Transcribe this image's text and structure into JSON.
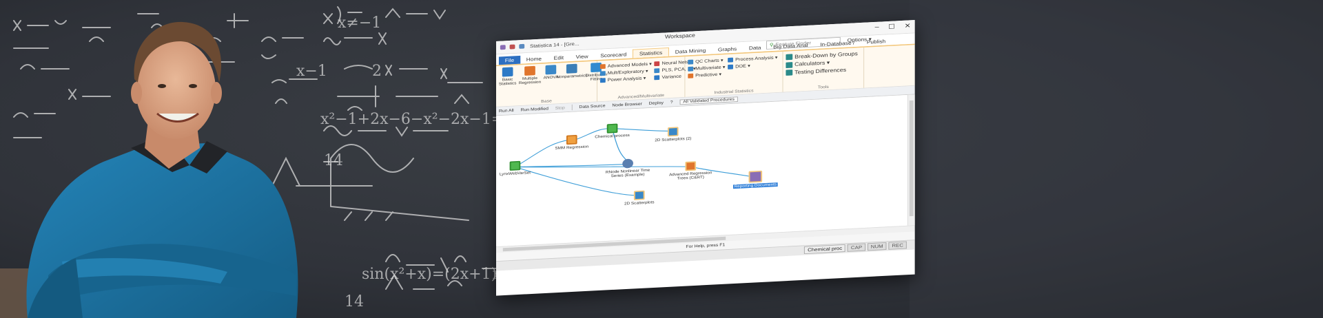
{
  "window": {
    "doc_title": "Statistica 14 - [Gre...",
    "title": "Workspace",
    "controls": [
      "–",
      "☐",
      "✕"
    ]
  },
  "menu": {
    "items": [
      "File",
      "Home",
      "Edit",
      "View",
      "Scorecard",
      "Statistics",
      "Data Mining",
      "Graphs",
      "Data",
      "Big Data Anal",
      "In-Database /",
      "Publish"
    ],
    "active": "Statistics",
    "search_placeholder": "Feature Finder",
    "options_label": "Options ▾"
  },
  "ribbon": {
    "base": {
      "label": "Base",
      "buttons": [
        "Basic Statistics",
        "Multiple Regression",
        "ANOVA",
        "Nonparametrics",
        "Distribution Fitting"
      ]
    },
    "advanced": {
      "label": "Advanced/Multivariate",
      "items": [
        "Advanced Models ▾",
        "Neural Nets ▾",
        "Mult/Exploratory ▾",
        "PLS, PCA, ... ▾",
        "Power Analysis ▾",
        "Variance"
      ]
    },
    "industrial": {
      "label": "Industrial Statistics",
      "items": [
        "QC Charts ▾",
        "Process Analysis ▾",
        "Multivariate ▾",
        "DOE ▾",
        "Predictive ▾"
      ]
    },
    "tools": {
      "label": "Tools",
      "items": [
        "Break-Down by Groups",
        "Calculators ▾",
        "Testing Differences"
      ]
    }
  },
  "toolbar": {
    "run_all": "Run All",
    "run_modified": "Run Modified",
    "stop": "Stop",
    "data_source": "Data Source",
    "node_browser": "Node Browser",
    "deploy": "Deploy",
    "help": "?",
    "procedures": "All Validated Procedures"
  },
  "workflow": {
    "nodes": [
      {
        "id": "lynx",
        "label": "LynxWebVarSet",
        "kind": "data"
      },
      {
        "id": "smm",
        "label": "SMM Regression",
        "kind": "analysis"
      },
      {
        "id": "chem",
        "label": "Chemical process",
        "kind": "data"
      },
      {
        "id": "scat2",
        "label": "2D Scatterplots (2)",
        "kind": "graph"
      },
      {
        "id": "rnode",
        "label": "RNode Nonlinear Time Series (Example)",
        "kind": "r"
      },
      {
        "id": "cart",
        "label": "Advanced Regression Trees (C&RT)",
        "kind": "tree"
      },
      {
        "id": "scat1",
        "label": "2D Scatterplots",
        "kind": "graph"
      },
      {
        "id": "report",
        "label": "Reporting Documents",
        "kind": "report"
      }
    ]
  },
  "help_text": "For Help, press F1",
  "status": {
    "doc": "Chemical proc",
    "cap": "CAP",
    "num": "NUM",
    "rec": "REC"
  },
  "colors": {
    "chalkboard": "#2e3137",
    "sweater": "#1c6e9c",
    "ribbon_accent": "#f3c77b",
    "link_blue": "#3e9ed8",
    "file_tab": "#2c6fc1"
  }
}
